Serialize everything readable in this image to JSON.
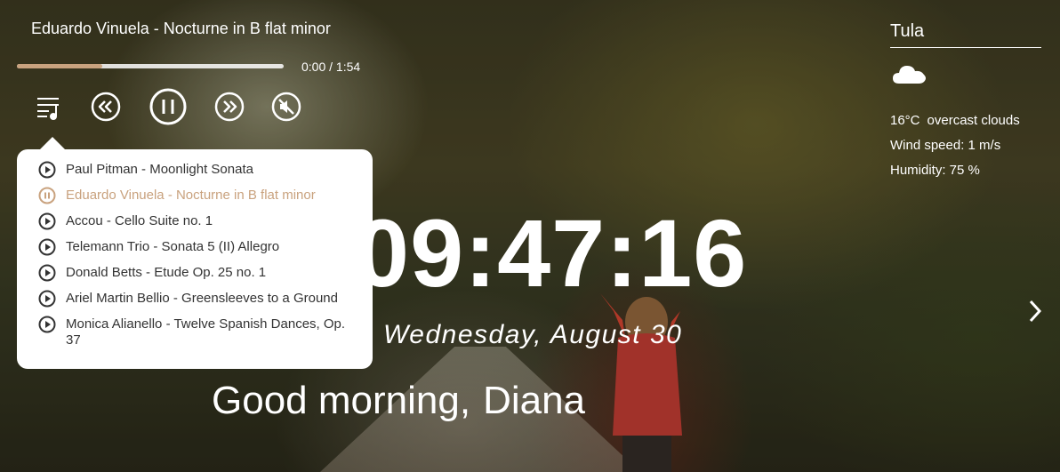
{
  "player": {
    "current_title": "Eduardo Vinuela - Nocturne in B flat minor",
    "current_time": "0:00",
    "duration": "1:54",
    "progress_fraction": 0.32,
    "controls": [
      "playlist-icon",
      "rewind-icon",
      "pause-icon",
      "forward-icon",
      "mute-icon"
    ]
  },
  "playlist": [
    {
      "title": "Paul Pitman - Moonlight Sonata",
      "state": "play"
    },
    {
      "title": "Eduardo Vinuela - Nocturne in B flat minor",
      "state": "pause"
    },
    {
      "title": "Accou - Cello Suite no. 1",
      "state": "play"
    },
    {
      "title": "Telemann Trio - Sonata 5 (II) Allegro",
      "state": "play"
    },
    {
      "title": "Donald Betts - Etude Op. 25 no. 1",
      "state": "play"
    },
    {
      "title": "Ariel Martin Bellio - Greensleeves to a Ground",
      "state": "play"
    },
    {
      "title": "Monica Alianello - Twelve Spanish Dances, Op. 37",
      "state": "play"
    }
  ],
  "clock": {
    "time": "09:47:16",
    "date": "Wednesday, August 30"
  },
  "greeting": {
    "text": "Good morning,",
    "name": "Diana"
  },
  "weather": {
    "city": "Tula",
    "icon": "cloud-icon",
    "temperature": "16°C",
    "description": "overcast clouds",
    "wind": "Wind speed: 1 m/s",
    "humidity": "Humidity: 75 %"
  },
  "colors": {
    "accent": "#c9a27e",
    "text": "#ffffff",
    "playlist_text": "#333333"
  }
}
